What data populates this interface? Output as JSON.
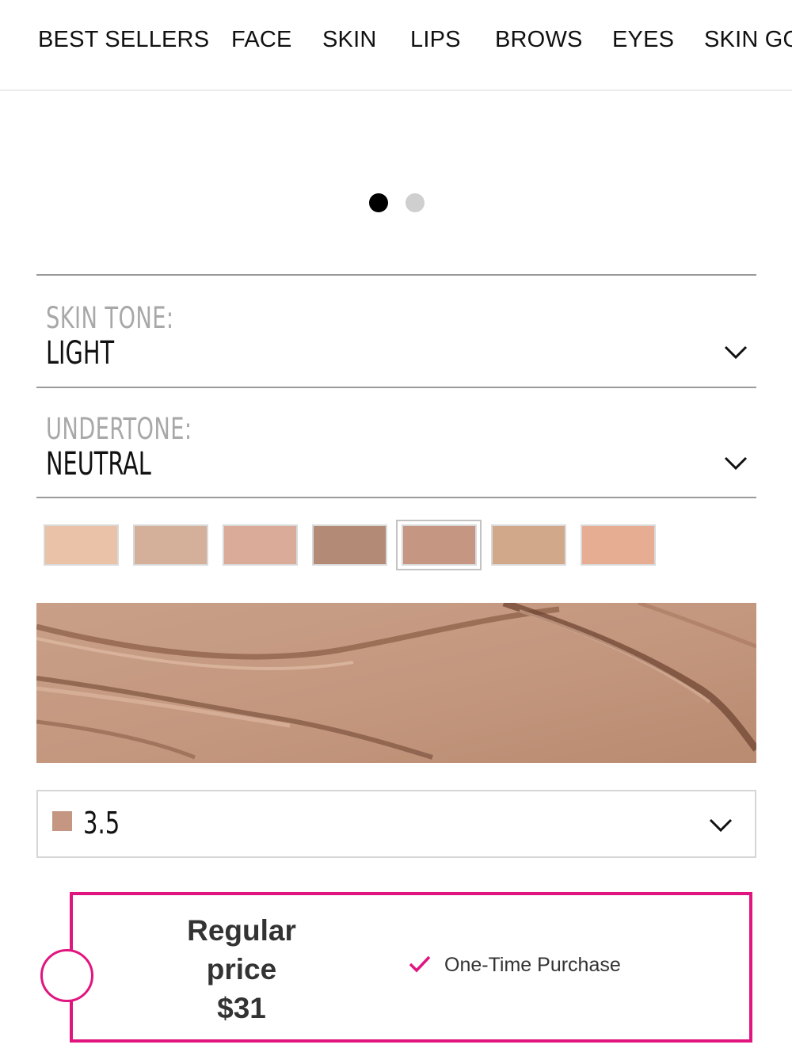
{
  "nav": {
    "items": [
      "BEST SELLERS",
      "FACE",
      "SKIN",
      "LIPS",
      "BROWS",
      "EYES",
      "SKIN GO"
    ]
  },
  "carousel": {
    "slide_count": 2,
    "active_index": 0
  },
  "skin_tone": {
    "label": "SKIN  TONE:",
    "value": "LIGHT"
  },
  "undertone": {
    "label": "UNDERTONE:",
    "value": "NEUTRAL"
  },
  "swatches": {
    "colors": [
      "#e9c2a8",
      "#d4b09a",
      "#d9ab98",
      "#b38a76",
      "#c59682",
      "#d2a88b",
      "#e6ad92"
    ],
    "selected_index": 4
  },
  "shade_select": {
    "value": "3.5",
    "chip_color": "#c59682"
  },
  "purchase": {
    "price_line1": "Regular",
    "price_line2": "price",
    "price_amount": "$31",
    "option_label": "One-Time Purchase",
    "accent_color": "#e0157f"
  }
}
